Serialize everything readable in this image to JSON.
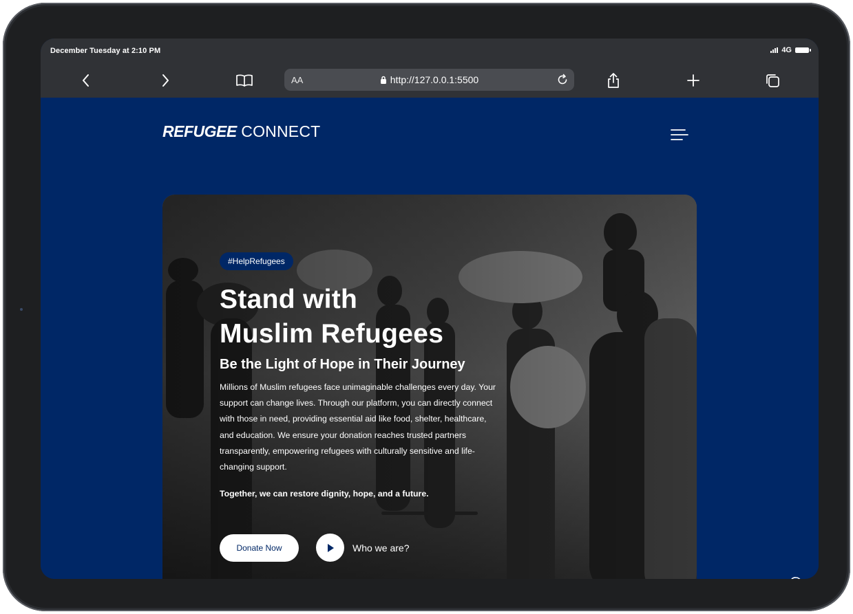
{
  "status_bar": {
    "time": "December Tuesday at 2:10 PM",
    "network": "4G",
    "signal_icon": "signal-bars-icon",
    "battery_icon": "battery-icon"
  },
  "toolbar": {
    "back_icon": "chevron-left-icon",
    "forward_icon": "chevron-right-icon",
    "bookmarks_icon": "book-icon",
    "text_size_label": "AA",
    "url": "http://127.0.0.1:5500",
    "reload_icon": "reload-icon",
    "share_icon": "share-icon",
    "new_tab_icon": "plus-icon",
    "tabs_icon": "tabs-icon"
  },
  "header": {
    "logo_bold": "REFUGEE",
    "logo_light": "CONNECT",
    "menu_icon": "hamburger-menu-icon"
  },
  "hero": {
    "tag": "#HelpRefugees",
    "headline_line1": "Stand with",
    "headline_line2": "Muslim Refugees",
    "subheadline": "Be the Light of Hope in Their Journey",
    "description": "Millions of Muslim refugees face unimaginable challenges every day. Your support can change lives. Through our platform, you can directly connect with those in need, providing essential aid like food, shelter, healthcare, and education. We ensure your donation reaches trusted partners transparently, empowering refugees with culturally sensitive and life-changing support.",
    "closing": "Together, we can restore dignity, hope, and a future.",
    "donate_label": "Donate Now",
    "play_icon": "play-icon",
    "who_label": "Who we are?"
  },
  "floating": {
    "whatsapp_icon": "whatsapp-icon"
  },
  "colors": {
    "brand_navy": "#002766",
    "browser_chrome": "#303236",
    "address_bar": "#4a4c51",
    "white": "#ffffff"
  }
}
